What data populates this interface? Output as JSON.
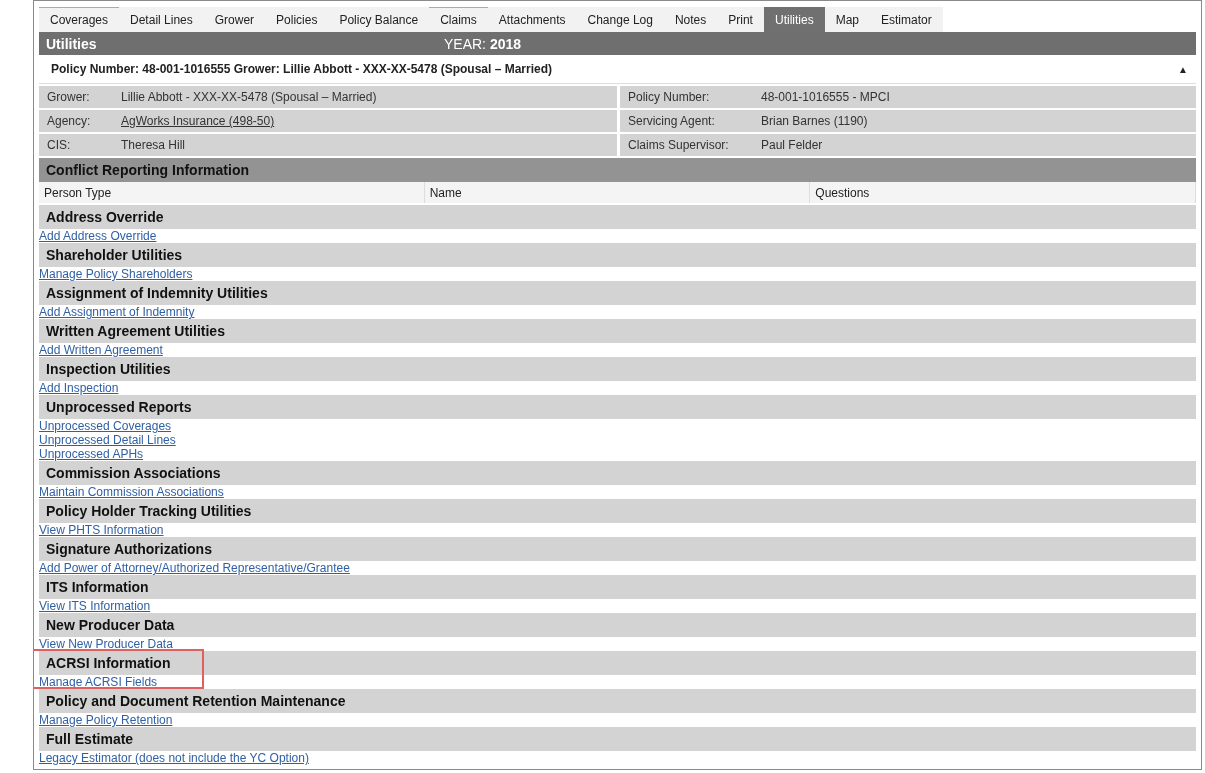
{
  "tabs": [
    {
      "label": "Coverages",
      "selected": false,
      "flagged": true
    },
    {
      "label": "Detail Lines",
      "selected": false,
      "flagged": false
    },
    {
      "label": "Grower",
      "selected": false,
      "flagged": false
    },
    {
      "label": "Policies",
      "selected": false,
      "flagged": false
    },
    {
      "label": "Policy Balance",
      "selected": false,
      "flagged": false
    },
    {
      "label": "Claims",
      "selected": false,
      "flagged": true
    },
    {
      "label": "Attachments",
      "selected": false,
      "flagged": false
    },
    {
      "label": "Change Log",
      "selected": false,
      "flagged": false
    },
    {
      "label": "Notes",
      "selected": false,
      "flagged": false
    },
    {
      "label": "Print",
      "selected": false,
      "flagged": false
    },
    {
      "label": "Utilities",
      "selected": true,
      "flagged": false
    },
    {
      "label": "Map",
      "selected": false,
      "flagged": false
    },
    {
      "label": "Estimator",
      "selected": false,
      "flagged": false
    }
  ],
  "title_bar": {
    "title": "Utilities",
    "year_label": "YEAR:",
    "year": "2018"
  },
  "policy_summary": {
    "text": "Policy Number: 48-001-1016555 Grower: Lillie Abbott - XXX-XX-5478 (Spousal – Married)",
    "collapse_glyph": "▲"
  },
  "info_rows": [
    {
      "left_label": "Grower:",
      "left_value": "Lillie Abbott - XXX-XX-5478 (Spousal – Married)",
      "left_is_link": false,
      "right_label": "Policy Number:",
      "right_value": "48-001-1016555 - MPCI"
    },
    {
      "left_label": "Agency:",
      "left_value": "AgWorks Insurance (498-50)",
      "left_is_link": true,
      "right_label": "Servicing Agent:",
      "right_value": "Brian Barnes (1190)"
    },
    {
      "left_label": "CIS:",
      "left_value": "Theresa Hill",
      "left_is_link": false,
      "right_label": "Claims Supervisor:",
      "right_value": "Paul Felder"
    }
  ],
  "conflict": {
    "title": "Conflict Reporting Information",
    "columns": [
      "Person Type",
      "Name",
      "Questions"
    ]
  },
  "sections": [
    {
      "title": "Address Override",
      "highlighted": false,
      "links": [
        "Add Address Override"
      ]
    },
    {
      "title": "Shareholder Utilities",
      "highlighted": false,
      "links": [
        "Manage Policy Shareholders"
      ]
    },
    {
      "title": "Assignment of Indemnity Utilities",
      "highlighted": false,
      "links": [
        "Add Assignment of Indemnity"
      ]
    },
    {
      "title": "Written Agreement Utilities",
      "highlighted": false,
      "links": [
        "Add Written Agreement"
      ]
    },
    {
      "title": "Inspection Utilities",
      "highlighted": false,
      "links": [
        "Add Inspection"
      ]
    },
    {
      "title": "Unprocessed Reports",
      "highlighted": false,
      "links": [
        "Unprocessed Coverages",
        "Unprocessed Detail Lines",
        "Unprocessed APHs"
      ]
    },
    {
      "title": "Commission Associations",
      "highlighted": false,
      "links": [
        "Maintain Commission Associations"
      ]
    },
    {
      "title": "Policy Holder Tracking Utilities",
      "highlighted": false,
      "links": [
        "View PHTS Information"
      ]
    },
    {
      "title": "Signature Authorizations",
      "highlighted": false,
      "links": [
        "Add Power of Attorney/Authorized Representative/Grantee"
      ]
    },
    {
      "title": "ITS Information",
      "highlighted": false,
      "links": [
        "View ITS Information"
      ]
    },
    {
      "title": "New Producer Data",
      "highlighted": false,
      "links": [
        "View New Producer Data"
      ]
    },
    {
      "title": "ACRSI Information",
      "highlighted": true,
      "links": [
        "Manage ACRSI Fields"
      ]
    },
    {
      "title": "Policy and Document Retention Maintenance",
      "highlighted": false,
      "links": [
        "Manage Policy Retention"
      ]
    },
    {
      "title": "Full Estimate",
      "highlighted": false,
      "links": [
        "Legacy Estimator (does not include the YC Option)"
      ]
    }
  ]
}
